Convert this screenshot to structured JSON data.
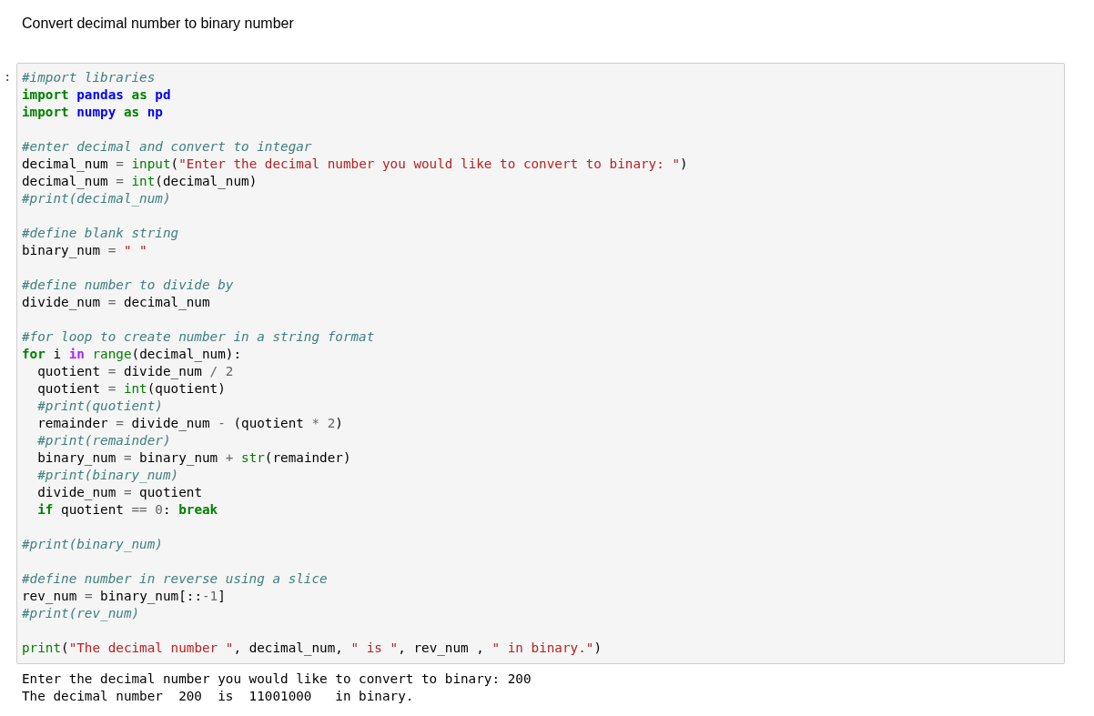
{
  "heading": "Convert decimal number to binary number",
  "cell": {
    "prompt": ":",
    "blocks": [
      [
        {
          "tokens": [
            {
              "kind": "comment",
              "text": "#import libraries"
            }
          ]
        },
        {
          "tokens": [
            {
              "kind": "keyword",
              "text": "import"
            },
            {
              "kind": "module",
              "text": " pandas"
            },
            {
              "kind": "keyword",
              "text": " as"
            },
            {
              "kind": "module",
              "text": " pd"
            }
          ]
        },
        {
          "tokens": [
            {
              "kind": "keyword",
              "text": "import"
            },
            {
              "kind": "module",
              "text": " numpy"
            },
            {
              "kind": "keyword",
              "text": " as"
            },
            {
              "kind": "module",
              "text": " np"
            }
          ]
        }
      ],
      [
        {
          "tokens": [
            {
              "kind": "comment",
              "text": "#enter decimal and convert to integar"
            }
          ]
        },
        {
          "tokens": [
            {
              "kind": "plain",
              "text": "decimal_num "
            },
            {
              "kind": "operator",
              "text": "="
            },
            {
              "kind": "builtin",
              "text": " input"
            },
            {
              "kind": "plain",
              "text": "("
            },
            {
              "kind": "string",
              "text": "\"Enter the decimal number you would like to convert to binary: \""
            },
            {
              "kind": "plain",
              "text": ")"
            }
          ]
        },
        {
          "tokens": [
            {
              "kind": "plain",
              "text": "decimal_num "
            },
            {
              "kind": "operator",
              "text": "="
            },
            {
              "kind": "builtin",
              "text": " int"
            },
            {
              "kind": "plain",
              "text": "(decimal_num)"
            }
          ]
        },
        {
          "tokens": [
            {
              "kind": "comment",
              "text": "#print(decimal_num)"
            }
          ]
        }
      ],
      [
        {
          "tokens": [
            {
              "kind": "comment",
              "text": "#define blank string"
            }
          ]
        },
        {
          "tokens": [
            {
              "kind": "plain",
              "text": "binary_num "
            },
            {
              "kind": "operator",
              "text": "="
            },
            {
              "kind": "string",
              "text": " \" \""
            }
          ]
        }
      ],
      [
        {
          "tokens": [
            {
              "kind": "comment",
              "text": "#define number to divide by"
            }
          ]
        },
        {
          "tokens": [
            {
              "kind": "plain",
              "text": "divide_num "
            },
            {
              "kind": "operator",
              "text": "="
            },
            {
              "kind": "plain",
              "text": " decimal_num"
            }
          ]
        }
      ],
      [
        {
          "tokens": [
            {
              "kind": "comment",
              "text": "#for loop to create number in a string format"
            }
          ]
        },
        {
          "tokens": [
            {
              "kind": "keyword",
              "text": "for"
            },
            {
              "kind": "plain",
              "text": " i "
            },
            {
              "kind": "word-operator",
              "text": "in"
            },
            {
              "kind": "builtin",
              "text": " range"
            },
            {
              "kind": "plain",
              "text": "(decimal_num):"
            }
          ]
        },
        {
          "tokens": [
            {
              "kind": "plain",
              "text": "  quotient "
            },
            {
              "kind": "operator",
              "text": "="
            },
            {
              "kind": "plain",
              "text": " divide_num "
            },
            {
              "kind": "operator",
              "text": "/"
            },
            {
              "kind": "number",
              "text": " 2"
            }
          ]
        },
        {
          "tokens": [
            {
              "kind": "plain",
              "text": "  quotient "
            },
            {
              "kind": "operator",
              "text": "="
            },
            {
              "kind": "builtin",
              "text": " int"
            },
            {
              "kind": "plain",
              "text": "(quotient)"
            }
          ]
        },
        {
          "tokens": [
            {
              "kind": "comment",
              "text": "  #print(quotient)"
            }
          ]
        },
        {
          "tokens": [
            {
              "kind": "plain",
              "text": "  remainder "
            },
            {
              "kind": "operator",
              "text": "="
            },
            {
              "kind": "plain",
              "text": " divide_num "
            },
            {
              "kind": "operator",
              "text": "-"
            },
            {
              "kind": "plain",
              "text": " (quotient "
            },
            {
              "kind": "operator",
              "text": "*"
            },
            {
              "kind": "number",
              "text": " 2"
            },
            {
              "kind": "plain",
              "text": ")"
            }
          ]
        },
        {
          "tokens": [
            {
              "kind": "comment",
              "text": "  #print(remainder)"
            }
          ]
        },
        {
          "tokens": [
            {
              "kind": "plain",
              "text": "  binary_num "
            },
            {
              "kind": "operator",
              "text": "="
            },
            {
              "kind": "plain",
              "text": " binary_num "
            },
            {
              "kind": "operator",
              "text": "+"
            },
            {
              "kind": "builtin",
              "text": " str"
            },
            {
              "kind": "plain",
              "text": "(remainder)"
            }
          ]
        },
        {
          "tokens": [
            {
              "kind": "comment",
              "text": "  #print(binary_num)"
            }
          ]
        },
        {
          "tokens": [
            {
              "kind": "plain",
              "text": "  divide_num "
            },
            {
              "kind": "operator",
              "text": "="
            },
            {
              "kind": "plain",
              "text": " quotient"
            }
          ]
        },
        {
          "tokens": [
            {
              "kind": "keyword",
              "text": "  if"
            },
            {
              "kind": "plain",
              "text": " quotient "
            },
            {
              "kind": "operator",
              "text": "=="
            },
            {
              "kind": "number",
              "text": " 0"
            },
            {
              "kind": "plain",
              "text": ": "
            },
            {
              "kind": "keyword",
              "text": "break"
            }
          ]
        }
      ],
      [
        {
          "tokens": [
            {
              "kind": "comment",
              "text": "#print(binary_num)"
            }
          ]
        }
      ],
      [
        {
          "tokens": [
            {
              "kind": "comment",
              "text": "#define number in reverse using a slice"
            }
          ]
        },
        {
          "tokens": [
            {
              "kind": "plain",
              "text": "rev_num "
            },
            {
              "kind": "operator",
              "text": "="
            },
            {
              "kind": "plain",
              "text": " binary_num[::"
            },
            {
              "kind": "operator",
              "text": "-"
            },
            {
              "kind": "number",
              "text": "1"
            },
            {
              "kind": "plain",
              "text": "]"
            }
          ]
        },
        {
          "tokens": [
            {
              "kind": "comment",
              "text": "#print(rev_num)"
            }
          ]
        }
      ],
      [
        {
          "tokens": [
            {
              "kind": "builtin",
              "text": "print"
            },
            {
              "kind": "plain",
              "text": "("
            },
            {
              "kind": "string",
              "text": "\"The decimal number \""
            },
            {
              "kind": "plain",
              "text": ", decimal_num, "
            },
            {
              "kind": "string",
              "text": "\" is \""
            },
            {
              "kind": "plain",
              "text": ", rev_num , "
            },
            {
              "kind": "string",
              "text": "\" in binary.\""
            },
            {
              "kind": "plain",
              "text": ")"
            }
          ]
        }
      ]
    ],
    "output": [
      "Enter the decimal number you would like to convert to binary: 200",
      "The decimal number  200  is  11001000   in binary."
    ]
  }
}
